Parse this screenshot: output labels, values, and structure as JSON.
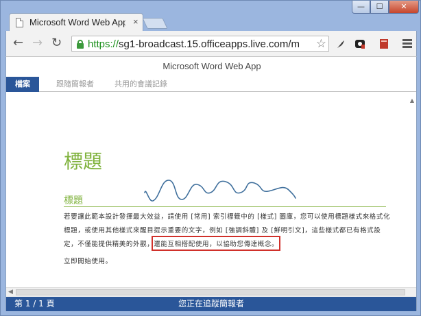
{
  "browser": {
    "tab_title": "Microsoft Word Web App",
    "tab_close": "×",
    "window_buttons": {
      "minimize": "—",
      "maximize": "☐",
      "close": "✕"
    },
    "nav": {
      "back": "←",
      "forward": "→",
      "reload": "↻"
    },
    "url": {
      "scheme": "https://",
      "host": "sg1-broadcast.15.officeapps.live.com/m"
    },
    "bookmark": "☆",
    "extension_colors": [
      "#444444",
      "#222222",
      "#c0392b"
    ]
  },
  "app": {
    "title": "Microsoft Word Web App",
    "tabs": [
      {
        "label": "檔案",
        "active": true
      },
      {
        "label": "跟隨簡報者",
        "active": false
      },
      {
        "label": "共用的會議記錄",
        "active": false
      }
    ]
  },
  "document": {
    "title": "標題",
    "heading": "標題",
    "paragraph_lines": [
      "若要讓此範本設計發揮最大效益，請使用 [常用] 索引標籤中的 [樣式] 圖庫，您可以使用標題樣式來格式化",
      "標題，或使用其他樣式來醒目提示重要的文字，例如 [強調斜體] 及 [鮮明引文]，這些樣式都已有格式設",
      "定，不僅能提供精美的外觀，還能互相搭配使用，以協助您傳達概念。"
    ],
    "closing_line": "立即開始使用。",
    "accent_color": "#7fb23c",
    "annotation_color": "#d0302a"
  },
  "statusbar": {
    "page_indicator": "第 1 / 1 頁",
    "status_text": "您正在追蹤簡報者"
  }
}
